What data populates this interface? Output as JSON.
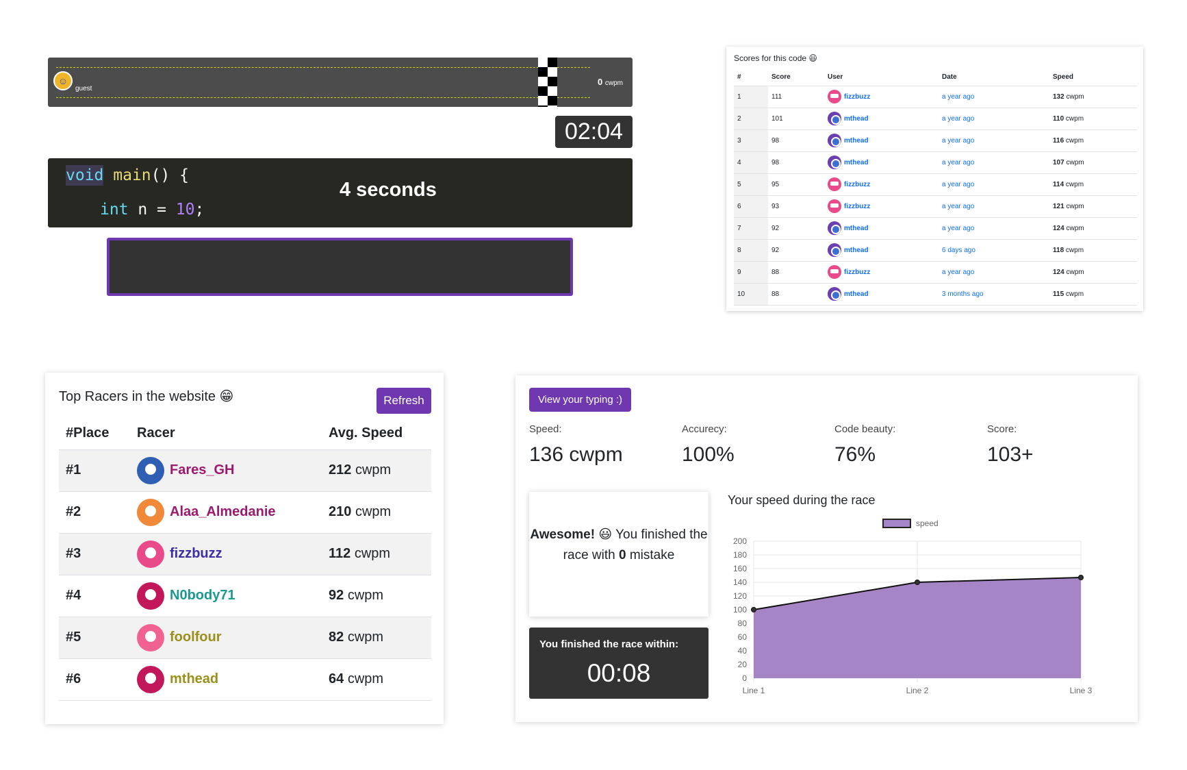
{
  "race": {
    "racer_name": "guest",
    "speed_value": "0",
    "speed_unit": "cwpm",
    "timer": "02:04",
    "countdown": "4 seconds",
    "code_line1": {
      "kw": "void",
      "fn": "main",
      "rest": "() {"
    },
    "code_line2": {
      "kw": "int",
      "mid": " n = ",
      "num": "10",
      "end": ";"
    }
  },
  "scores": {
    "title": "Scores for this code 😃",
    "headers": [
      "#",
      "Score",
      "User",
      "Date",
      "Speed"
    ],
    "unit": "cwpm",
    "rows": [
      {
        "rank": "1",
        "score": "111",
        "user": "fizzbuzz",
        "date": "a year ago",
        "speed": "132"
      },
      {
        "rank": "2",
        "score": "101",
        "user": "mthead",
        "date": "a year ago",
        "speed": "110"
      },
      {
        "rank": "3",
        "score": "98",
        "user": "mthead",
        "date": "a year ago",
        "speed": "116"
      },
      {
        "rank": "4",
        "score": "98",
        "user": "mthead",
        "date": "a year ago",
        "speed": "107"
      },
      {
        "rank": "5",
        "score": "95",
        "user": "fizzbuzz",
        "date": "a year ago",
        "speed": "114"
      },
      {
        "rank": "6",
        "score": "93",
        "user": "fizzbuzz",
        "date": "a year ago",
        "speed": "121"
      },
      {
        "rank": "7",
        "score": "92",
        "user": "mthead",
        "date": "a year ago",
        "speed": "124"
      },
      {
        "rank": "8",
        "score": "92",
        "user": "mthead",
        "date": "6 days ago",
        "speed": "118"
      },
      {
        "rank": "9",
        "score": "88",
        "user": "fizzbuzz",
        "date": "a year ago",
        "speed": "124"
      },
      {
        "rank": "10",
        "score": "88",
        "user": "mthead",
        "date": "3 months ago",
        "speed": "115"
      }
    ]
  },
  "top_racers": {
    "title": "Top Racers in the website 😁",
    "refresh_label": "Refresh",
    "headers": [
      "#Place",
      "Racer",
      "Avg. Speed"
    ],
    "unit": "cwpm",
    "rows": [
      {
        "place": "#1",
        "name": "Fares_GH",
        "speed": "212",
        "name_color": "#9c1a6e",
        "avatar_color": "#2f5fb3"
      },
      {
        "place": "#2",
        "name": "Alaa_Almedanie",
        "speed": "210",
        "name_color": "#9c1a6e",
        "avatar_color": "#f08a3a"
      },
      {
        "place": "#3",
        "name": "fizzbuzz",
        "speed": "112",
        "name_color": "#3b2ea6",
        "avatar_color": "#e84a8a"
      },
      {
        "place": "#4",
        "name": "N0body71",
        "speed": "92",
        "name_color": "#1a9a8f",
        "avatar_color": "#c2185b"
      },
      {
        "place": "#5",
        "name": "foolfour",
        "speed": "82",
        "name_color": "#9a8f1a",
        "avatar_color": "#f06292"
      },
      {
        "place": "#6",
        "name": "mthead",
        "speed": "64",
        "name_color": "#9a8f1a",
        "avatar_color": "#c2185b"
      }
    ]
  },
  "results": {
    "view_label": "View your typing :)",
    "stats": [
      {
        "label": "Speed:",
        "value": "136 cwpm"
      },
      {
        "label": "Accurecy:",
        "value": "100%"
      },
      {
        "label": "Code beauty:",
        "value": "76%"
      },
      {
        "label": "Score:",
        "value": "103+"
      }
    ],
    "awesome": {
      "bold": "Awesome! 😃",
      "text1": " You finished the race with ",
      "mistakes": "0",
      "text2": " mistake"
    },
    "finish_label": "You finished the race within:",
    "finish_time": "00:08",
    "chart_title": "Your speed during the race"
  },
  "chart_data": {
    "type": "area",
    "categories": [
      "Line 1",
      "Line 2",
      "Line 3"
    ],
    "series": [
      {
        "name": "speed",
        "values": [
          100,
          140,
          147
        ]
      }
    ],
    "ylim": [
      0,
      200
    ],
    "yticks": [
      0,
      20,
      40,
      60,
      80,
      100,
      120,
      140,
      160,
      180,
      200
    ],
    "legend": "top",
    "fill_color": "#a585c6",
    "line_color": "#111111",
    "grid": true
  }
}
